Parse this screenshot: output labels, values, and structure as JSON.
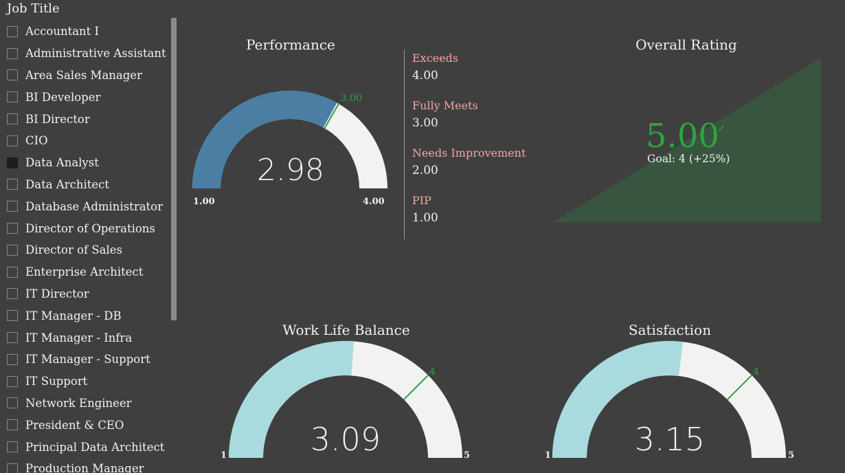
{
  "slicer": {
    "title": "Job Title",
    "items": [
      {
        "label": "Accountant I",
        "checked": false
      },
      {
        "label": "Administrative Assistant",
        "checked": false
      },
      {
        "label": "Area Sales Manager",
        "checked": false
      },
      {
        "label": "BI Developer",
        "checked": false
      },
      {
        "label": "BI Director",
        "checked": false
      },
      {
        "label": "CIO",
        "checked": false
      },
      {
        "label": "Data Analyst",
        "checked": true
      },
      {
        "label": "Data Architect",
        "checked": false
      },
      {
        "label": "Database Administrator",
        "checked": false
      },
      {
        "label": "Director of Operations",
        "checked": false
      },
      {
        "label": "Director of Sales",
        "checked": false
      },
      {
        "label": "Enterprise Architect",
        "checked": false
      },
      {
        "label": "IT Director",
        "checked": false
      },
      {
        "label": "IT Manager - DB",
        "checked": false
      },
      {
        "label": "IT Manager - Infra",
        "checked": false
      },
      {
        "label": "IT Manager - Support",
        "checked": false
      },
      {
        "label": "IT Support",
        "checked": false
      },
      {
        "label": "Network Engineer",
        "checked": false
      },
      {
        "label": "President & CEO",
        "checked": false
      },
      {
        "label": "Principal Data Architect",
        "checked": false
      },
      {
        "label": "Production Manager",
        "checked": false
      }
    ]
  },
  "performance": {
    "title": "Performance",
    "value_text": "2.98",
    "min_label": "1.00",
    "max_label": "4.00",
    "target_label": "3.00",
    "legend": [
      {
        "name": "Exceeds",
        "value": "4.00"
      },
      {
        "name": "Fully Meets",
        "value": "3.00"
      },
      {
        "name": "Needs Improvement",
        "value": "2.00"
      },
      {
        "name": "PIP",
        "value": "1.00"
      }
    ]
  },
  "overall_rating": {
    "title": "Overall Rating",
    "value_text": "5.00",
    "check_icon": "check-icon",
    "goal_text": "Goal: 4 (+25%)"
  },
  "work_life_balance": {
    "title": "Work Life Balance",
    "value_text": "3.09",
    "min_label": "1",
    "max_label": "5",
    "target_label": "4"
  },
  "satisfaction": {
    "title": "Satisfaction",
    "value_text": "3.15",
    "min_label": "1",
    "max_label": "5",
    "target_label": "4"
  },
  "colors": {
    "background": "#3f3f3f",
    "performance_fill": "#4a7fa3",
    "soft_fill": "#a9dade",
    "gauge_track": "#f2f2f2",
    "target_line": "#2e9e44",
    "kpi_good": "#2ba63e",
    "kpi_background": "#3a553f",
    "legend_text": "#f4a4a4"
  },
  "chart_data": [
    {
      "type": "gauge",
      "title": "Performance",
      "min": 1,
      "max": 4,
      "value": 2.98,
      "target": 3
    },
    {
      "type": "gauge",
      "title": "Work Life Balance",
      "min": 1,
      "max": 5,
      "value": 3.09,
      "target": 4
    },
    {
      "type": "gauge",
      "title": "Satisfaction",
      "min": 1,
      "max": 5,
      "value": 3.15,
      "target": 4
    },
    {
      "type": "kpi",
      "title": "Overall Rating",
      "value": 5,
      "goal": 4,
      "change_pct": 25
    }
  ]
}
